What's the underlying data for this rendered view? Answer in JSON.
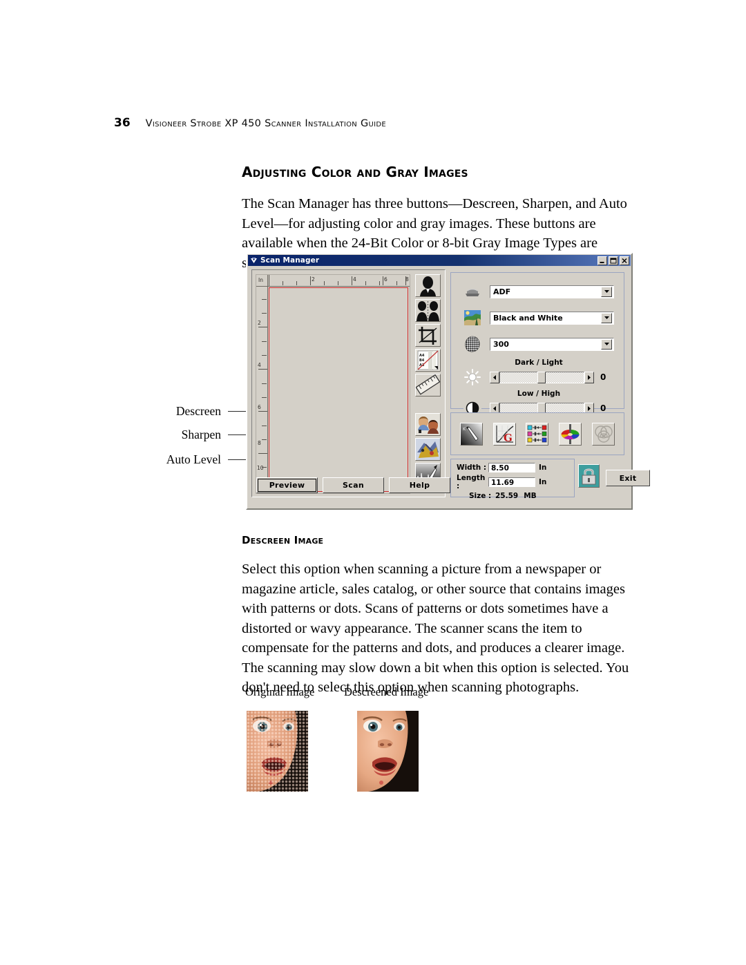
{
  "page": {
    "folio": "36",
    "running_header": "Visioneer Strobe XP 450 Scanner Installation Guide"
  },
  "content": {
    "section_heading": "Adjusting Color and Gray Images",
    "intro_paragraph": "The Scan Manager has three buttons—Descreen, Sharpen, and Auto Level—for adjusting color and gray images. These buttons are available when the 24-Bit Color or 8-bit Gray Image Types are selected.",
    "sub_heading": "Descreen Image",
    "descreen_paragraph": "Select this option when scanning a picture from a newspaper or magazine article, sales catalog, or other source that contains images with patterns or dots. Scans of patterns or dots sometimes have a distorted or wavy appearance. The scanner scans the item to compensate for the patterns and dots, and produces a clearer image. The scanning may slow down a bit when this option is selected. You don't need to select this option when scanning photographs."
  },
  "callouts": [
    {
      "label": "Descreen"
    },
    {
      "label": "Sharpen"
    },
    {
      "label": "Auto Level"
    }
  ],
  "scan_manager": {
    "title": "Scan Manager",
    "window_buttons": [
      {
        "name": "minimize",
        "glyph": "minimize-icon"
      },
      {
        "name": "maximize",
        "glyph": "maximize-icon"
      },
      {
        "name": "close",
        "glyph": "close-icon"
      }
    ],
    "ruler": {
      "unit_label": "In",
      "horizontal_labels": [
        "2",
        "4",
        "6",
        "8"
      ],
      "vertical_labels": [
        "2",
        "4",
        "6",
        "8",
        "10"
      ]
    },
    "tools": [
      {
        "name": "portrait-tool",
        "icon": "portrait-icon"
      },
      {
        "name": "mirror-tool",
        "icon": "mirror-icon"
      },
      {
        "name": "crop-tool",
        "icon": "crop-icon"
      },
      {
        "name": "paper-size-tool",
        "icon": "paper-size-icon"
      },
      {
        "name": "ruler-tool",
        "icon": "ruler-icon"
      },
      {
        "name": "descreen-tool",
        "icon": "descreen-icon"
      },
      {
        "name": "sharpen-tool",
        "icon": "sharpen-icon"
      },
      {
        "name": "auto-level-tool",
        "icon": "auto-level-icon"
      }
    ],
    "settings": {
      "source": {
        "icon": "scanner-icon",
        "value": "ADF"
      },
      "image_type": {
        "icon": "photo-icon",
        "value": "Black and White"
      },
      "resolution": {
        "icon": "halftone-icon",
        "value": "300"
      },
      "dark_light": {
        "icon": "brightness-icon",
        "label": "Dark / Light",
        "value": "0"
      },
      "low_high": {
        "icon": "contrast-icon",
        "label": "Low / High",
        "value": "0"
      }
    },
    "adjust_tools": [
      {
        "name": "brightness-contrast",
        "icon": "eyedropper-gradient-icon"
      },
      {
        "name": "gamma-curve",
        "icon": "gamma-curve-icon"
      },
      {
        "name": "color-balance",
        "icon": "color-balance-icon"
      },
      {
        "name": "hue-saturation",
        "icon": "color-wheel-icon"
      },
      {
        "name": "advanced-disabled",
        "icon": "circles-icon"
      }
    ],
    "size_panel": {
      "width_label": "Width :",
      "width_value": "8.50",
      "width_unit": "In",
      "length_label": "Length :",
      "length_value": "11.69",
      "length_unit": "In",
      "size_label": "Size :",
      "size_value": "25.59",
      "size_unit": "MB",
      "lock_icon": "lock-icon"
    },
    "buttons": {
      "preview": "Preview",
      "scan": "Scan",
      "help": "Help",
      "exit": "Exit"
    }
  },
  "samples": [
    {
      "caption": "Original Image"
    },
    {
      "caption": "Descreened Image"
    }
  ],
  "colors": {
    "titlebar_start": "#0a246a",
    "titlebar_end": "#5a7bbf",
    "dialog_face": "#d4d0c8",
    "scan_area_border": "#d02a2a",
    "lock_teal": "#3e9e9e"
  }
}
